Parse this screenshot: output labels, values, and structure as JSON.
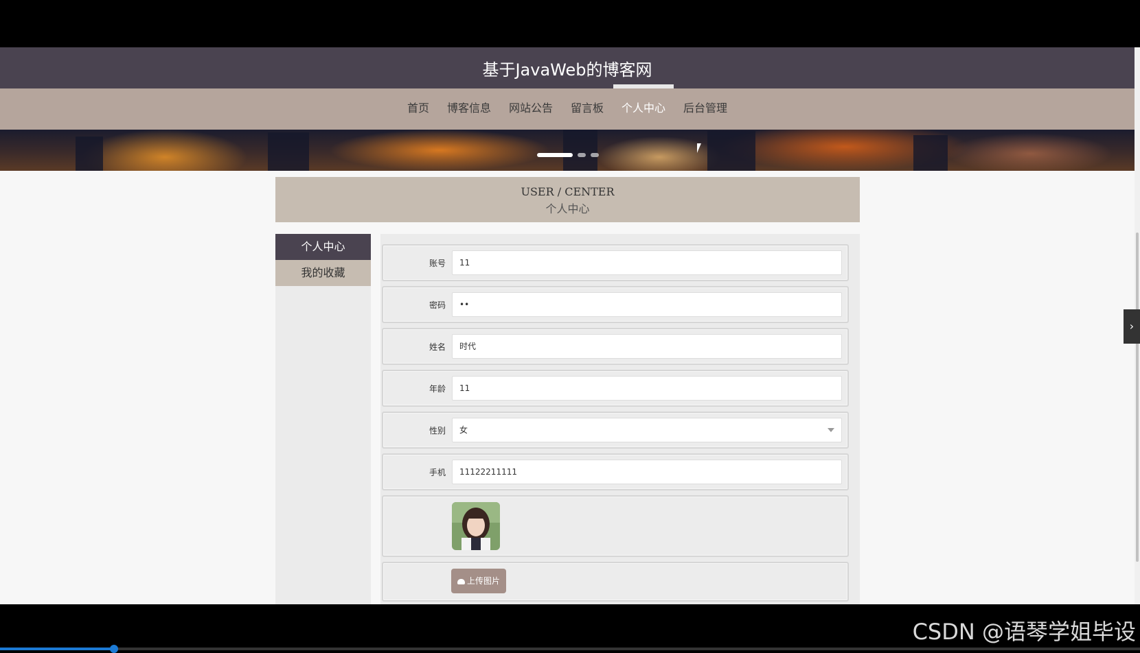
{
  "site_title": "基于JavaWeb的博客网",
  "nav": {
    "items": [
      {
        "label": "首页"
      },
      {
        "label": "博客信息"
      },
      {
        "label": "网站公告"
      },
      {
        "label": "留言板"
      },
      {
        "label": "个人中心"
      },
      {
        "label": "后台管理"
      }
    ],
    "active_index": 4
  },
  "banner": {
    "slide_count": 3,
    "active_slide": 0
  },
  "section": {
    "title_en": "USER / CENTER",
    "title_cn": "个人中心"
  },
  "sidebar": {
    "items": [
      {
        "label": "个人中心"
      },
      {
        "label": "我的收藏"
      }
    ],
    "active_index": 0
  },
  "form": {
    "account_label": "账号",
    "account_value": "11",
    "password_label": "密码",
    "password_value": "••",
    "name_label": "姓名",
    "name_value": "时代",
    "age_label": "年龄",
    "age_value": "11",
    "gender_label": "性别",
    "gender_value": "女",
    "phone_label": "手机",
    "phone_value": "11122211111",
    "upload_label": "上传图片"
  },
  "watermark": "CSDN @语琴学姐毕设",
  "video_progress": 0.1,
  "colors": {
    "header": "#4a4350",
    "nav": "#b5a59c",
    "title_box": "#c6bcb1",
    "upload_btn": "#a48f88"
  }
}
